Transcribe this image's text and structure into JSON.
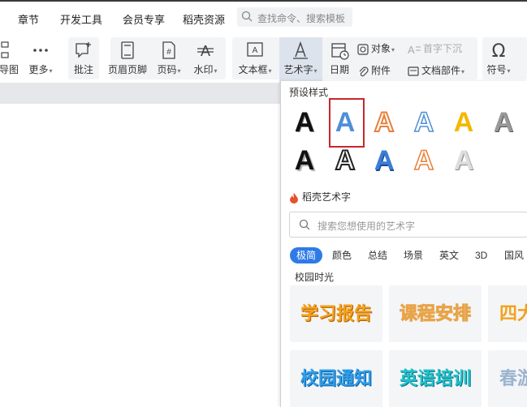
{
  "menu": {
    "items": [
      "章节",
      "开发工具",
      "会员专享",
      "稻壳资源"
    ],
    "search_placeholder": "查找命令、搜索模板"
  },
  "ribbon": {
    "mindmap": "导图",
    "more": "更多",
    "comment": "批注",
    "header_footer": "页眉页脚",
    "page_number": "页码",
    "watermark": "水印",
    "textbox": "文本框",
    "wordart": "艺术字",
    "date": "日期",
    "object": "对象",
    "dropcap": "首字下沉",
    "attachment": "附件",
    "doc_parts": "文档部件",
    "symbol": "符号"
  },
  "panel": {
    "preset_title": "预设样式",
    "preset_glyph": "A",
    "docer_title": "稻壳艺术字",
    "search_placeholder": "搜索您想使用的艺术字",
    "tabs": [
      "极简",
      "颜色",
      "总结",
      "场景",
      "英文",
      "3D",
      "国风"
    ],
    "active_tab": "极简",
    "campus_label": "校园时光",
    "tiles": [
      "学习报告",
      "课程安排",
      "四大",
      "校园通知",
      "英语培训",
      "春游"
    ]
  },
  "colors": {
    "accent": "#2f7be6",
    "selection": "#c8262c"
  }
}
